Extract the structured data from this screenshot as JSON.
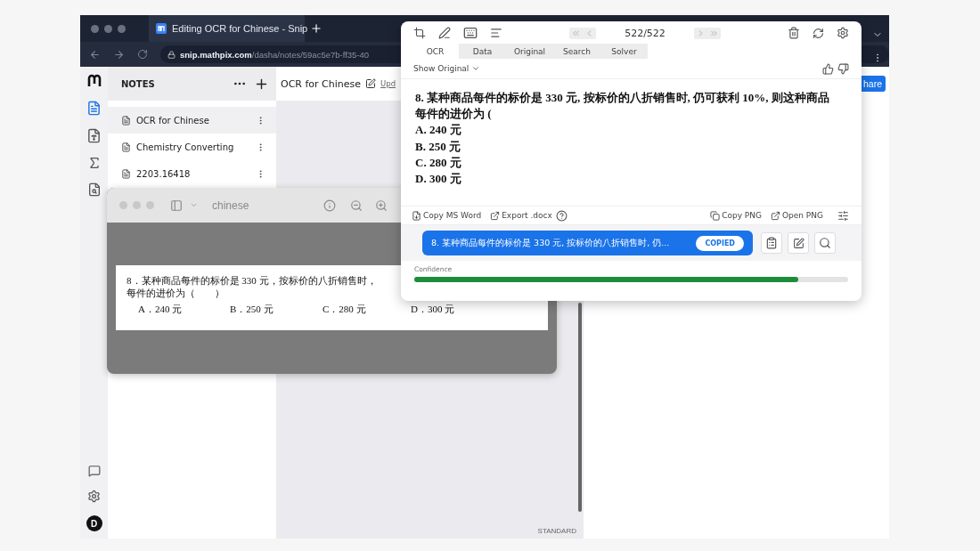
{
  "browser": {
    "tab_title": "Editing OCR for Chinese - Snip",
    "url_host": "snip.mathpix.com",
    "url_path": "/dasha/notes/59ac5e7b-ff35-40"
  },
  "app": {
    "rail": [
      {
        "kind": "notes",
        "selected": true
      },
      {
        "kind": "pdf",
        "selected": false
      },
      {
        "kind": "math",
        "selected": false
      },
      {
        "kind": "search",
        "selected": false
      }
    ],
    "avatar": "D",
    "notes_header": "NOTES",
    "notes": [
      {
        "title": "OCR for Chinese",
        "selected": true
      },
      {
        "title": "Chemistry Converting",
        "selected": false
      },
      {
        "title": "2203.16418",
        "selected": false
      }
    ],
    "note_title": "OCR for Chinese",
    "update_link": "Upd",
    "share_button": "hare",
    "mode": "STANDARD"
  },
  "preview_window": {
    "title": "chinese",
    "question_lines": [
      "8．某种商品每件的标价是 330 元，按标价的八折销售时，",
      "每件的进价为（　　）"
    ],
    "options": [
      "A．240 元",
      "B．250 元",
      "C．280 元",
      "D．300 元"
    ]
  },
  "snip_popup": {
    "counter": "522/522",
    "tabs": [
      {
        "label": "OCR",
        "selected": true
      },
      {
        "label": "Data",
        "selected": false
      },
      {
        "label": "Original",
        "selected": false
      },
      {
        "label": "Search",
        "selected": false
      },
      {
        "label": "Solver",
        "selected": false
      }
    ],
    "show_original": "Show Original",
    "ocr_lines": [
      "8. 某种商品每件的标价是 330 元, 按标价的八折销售时, 仍可获利 10%, 则这种商品",
      "每件的进价为 (",
      "A. 240 元",
      "B. 250 元",
      "C. 280 元",
      "D. 300 元"
    ],
    "actions_left": [
      "Copy MS Word",
      "Export .docx"
    ],
    "actions_right": [
      "Copy PNG",
      "Open PNG"
    ],
    "copy_bar": {
      "text": "8. 某种商品每件的标价是 330 元, 按标价的八折销售时, 仍...",
      "badge": "COPIED"
    },
    "confidence": {
      "label": "Confidence",
      "level": 0.885
    }
  }
}
